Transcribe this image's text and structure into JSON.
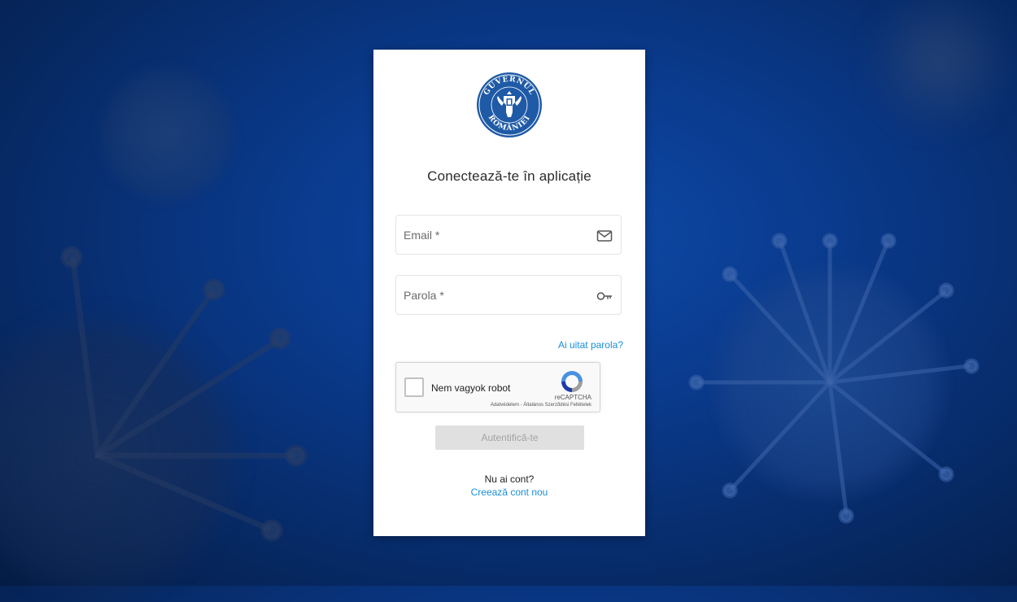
{
  "logo": {
    "text_top": "GUVERNUL",
    "text_bottom": "ROMÂNIEI",
    "color": "#1f5aa6"
  },
  "login": {
    "title": "Conectează-te în aplicație",
    "email_placeholder": "Email *",
    "password_placeholder": "Parola *",
    "forgot_password": "Ai uitat parola?",
    "submit_label": "Autentifică-te",
    "no_account": "Nu ai cont?",
    "create_account": "Creează cont nou"
  },
  "recaptcha": {
    "label": "Nem vagyok robot",
    "brand": "reCAPTCHA",
    "links": "Adatvédelem - Általános Szerződési Feltételek",
    "checked": false
  },
  "colors": {
    "link": "#1a8fd8",
    "background": "#0a3a8c",
    "button_disabled": "#e0e0e0"
  }
}
